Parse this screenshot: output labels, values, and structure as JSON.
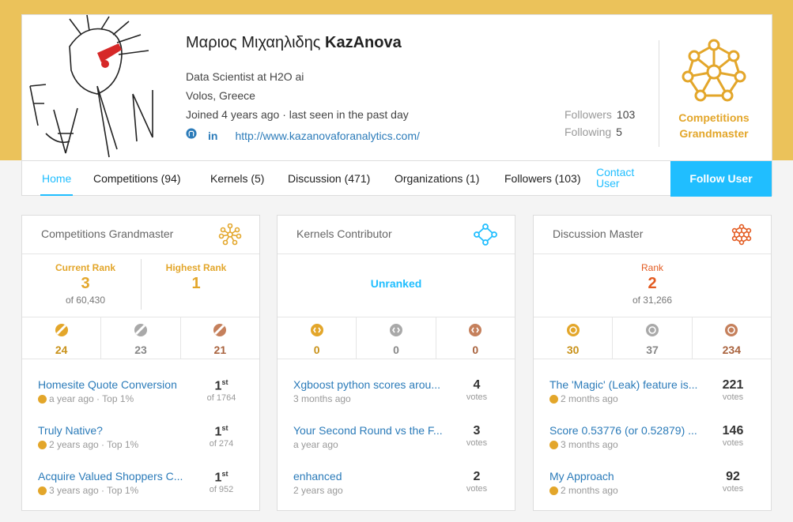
{
  "colors": {
    "band": "#ebc25a",
    "accent": "#20beff",
    "gold": "#e3a62a",
    "silver": "#a9a9a9",
    "bronze": "#c5805c",
    "orange": "#e35b21",
    "link": "#2b7bb9"
  },
  "profile": {
    "name": "Μαριος Μιχαηλιδης",
    "username": "KazAnova",
    "occupation": "Data Scientist at H2O ai",
    "location": "Volos, Greece",
    "joined": "Joined 4 years ago · last seen in the past day",
    "website": "http://www.kazanovaforanalytics.com/",
    "followers_label": "Followers",
    "followers_count": "103",
    "following_label": "Following",
    "following_count": "5",
    "tier_line1": "Competitions",
    "tier_line2": "Grandmaster"
  },
  "nav": {
    "home": "Home",
    "competitions": "Competitions (94)",
    "kernels": "Kernels (5)",
    "discussion": "Discussion (471)",
    "organizations": "Organizations (1)",
    "followers": "Followers (103)",
    "contact_line1": "Contact",
    "contact_line2": "User",
    "follow_button": "Follow User"
  },
  "cards": {
    "competitions": {
      "title": "Competitions Grandmaster",
      "current_rank_label": "Current Rank",
      "current_rank": "3",
      "current_of": "of 60,430",
      "highest_rank_label": "Highest Rank",
      "highest_rank": "1",
      "medals": {
        "gold": "24",
        "silver": "23",
        "bronze": "21"
      },
      "items": [
        {
          "title": "Homesite Quote Conversion",
          "sub": "a year ago · Top 1%",
          "rank": "1",
          "suffix": "st",
          "of": "of 1764"
        },
        {
          "title": "Truly Native?",
          "sub": "2 years ago · Top 1%",
          "rank": "1",
          "suffix": "st",
          "of": "of 274"
        },
        {
          "title": "Acquire Valued Shoppers C...",
          "sub": "3 years ago · Top 1%",
          "rank": "1",
          "suffix": "st",
          "of": "of 952"
        }
      ]
    },
    "kernels": {
      "title": "Kernels Contributor",
      "unranked": "Unranked",
      "medals": {
        "gold": "0",
        "silver": "0",
        "bronze": "0"
      },
      "items": [
        {
          "title": "Xgboost python scores arou...",
          "sub": "3 months ago",
          "votes": "4",
          "votes_label": "votes"
        },
        {
          "title": "Your Second Round vs the F...",
          "sub": "a year ago",
          "votes": "3",
          "votes_label": "votes"
        },
        {
          "title": "enhanced",
          "sub": "2 years ago",
          "votes": "2",
          "votes_label": "votes"
        }
      ]
    },
    "discussion": {
      "title": "Discussion Master",
      "rank_label": "Rank",
      "rank": "2",
      "rank_of": "of 31,266",
      "medals": {
        "gold": "30",
        "silver": "37",
        "bronze": "234"
      },
      "items": [
        {
          "title": "The 'Magic' (Leak) feature is...",
          "sub": "2 months ago",
          "votes": "221",
          "votes_label": "votes"
        },
        {
          "title": "Score 0.53776 (or 0.52879) ...",
          "sub": "3 months ago",
          "votes": "146",
          "votes_label": "votes"
        },
        {
          "title": "My Approach",
          "sub": "2 months ago",
          "votes": "92",
          "votes_label": "votes"
        }
      ]
    }
  }
}
